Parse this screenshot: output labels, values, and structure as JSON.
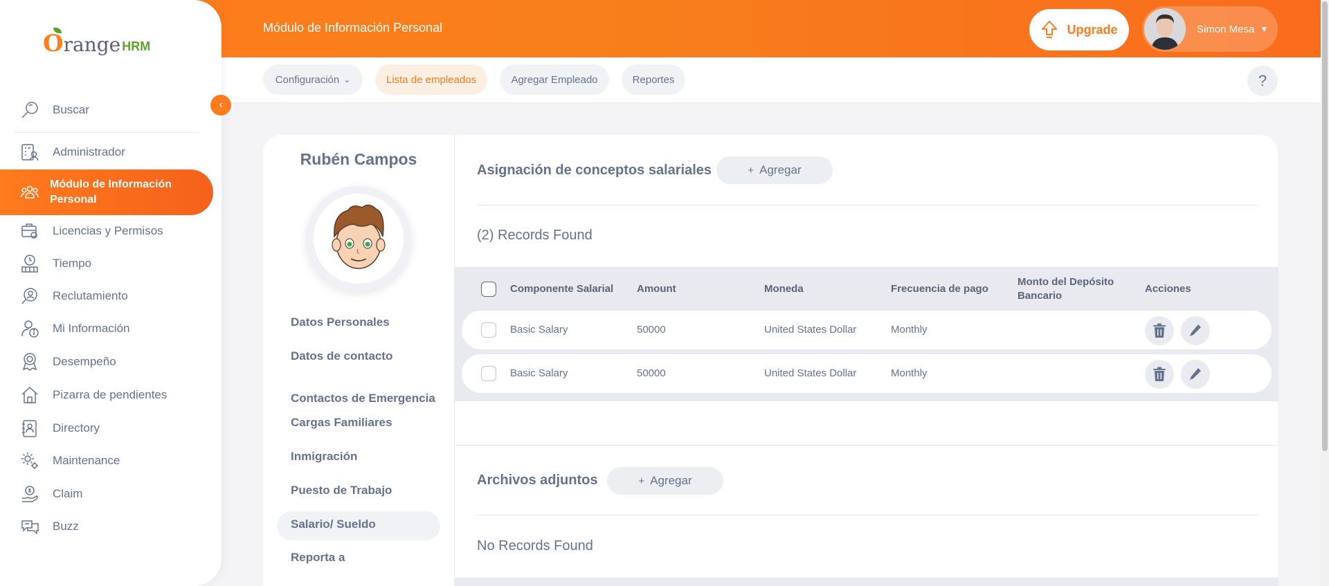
{
  "app": {
    "logo_word": "range",
    "logo_suffix": "HRM"
  },
  "header": {
    "module_title": "Módulo de Información Personal",
    "upgrade_label": "Upgrade",
    "user_name": "Simon Mesa"
  },
  "subnav": {
    "items": [
      {
        "label": "Configuración"
      },
      {
        "label": "Lista de empleados"
      },
      {
        "label": "Agregar Empleado"
      },
      {
        "label": "Reportes"
      }
    ],
    "help_label": "?"
  },
  "sidebar": {
    "search_label": "Buscar",
    "items": [
      {
        "label": "Administrador",
        "icon": "admin-icon"
      },
      {
        "label": "Módulo de Información Personal",
        "icon": "people-icon"
      },
      {
        "label": "Licencias y Permisos",
        "icon": "leave-icon"
      },
      {
        "label": "Tiempo",
        "icon": "time-icon"
      },
      {
        "label": "Reclutamiento",
        "icon": "recruitment-icon"
      },
      {
        "label": "Mi Información",
        "icon": "my-info-icon"
      },
      {
        "label": "Desempeño",
        "icon": "performance-icon"
      },
      {
        "label": "Pizarra de pendientes",
        "icon": "dashboard-icon"
      },
      {
        "label": "Directory",
        "icon": "directory-icon"
      },
      {
        "label": "Maintenance",
        "icon": "maintenance-icon"
      },
      {
        "label": "Claim",
        "icon": "claim-icon"
      },
      {
        "label": "Buzz",
        "icon": "buzz-icon"
      }
    ]
  },
  "profile": {
    "name": "Rubén Campos",
    "menu": [
      {
        "label": "Datos Personales"
      },
      {
        "label": "Datos de contacto"
      },
      {
        "label": "Contactos de Emergencia"
      },
      {
        "label": "Cargas Familiares"
      },
      {
        "label": "Inmigración"
      },
      {
        "label": "Puesto de Trabajo"
      },
      {
        "label": "Salario/ Sueldo"
      },
      {
        "label": "Reporta a"
      }
    ]
  },
  "salary_section": {
    "title": "Asignación de conceptos salariales",
    "add_label": "Agregar",
    "records_text": "(2) Records Found",
    "columns": [
      "Componente Salarial",
      "Amount",
      "Moneda",
      "Frecuencia de pago",
      "Monto del Depósito Bancario",
      "Acciones"
    ],
    "rows": [
      {
        "component": "Basic Salary",
        "amount": "50000",
        "currency": "United States Dollar",
        "frequency": "Monthly",
        "deposit": ""
      },
      {
        "component": "Basic Salary",
        "amount": "50000",
        "currency": "United States Dollar",
        "frequency": "Monthly",
        "deposit": ""
      }
    ]
  },
  "attachments_section": {
    "title": "Archivos adjuntos",
    "add_label": "Agregar",
    "records_text": "No Records Found"
  },
  "colors": {
    "brand_orange": "#ff7b1d",
    "text_gray": "#64728c",
    "logo_green": "#5fa22b"
  }
}
